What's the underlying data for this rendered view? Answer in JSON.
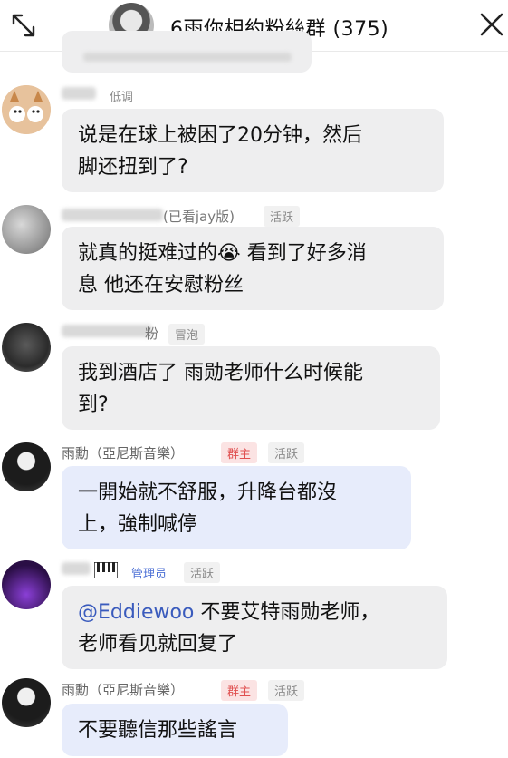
{
  "header": {
    "title": "6雨你相約粉絲群 (375)"
  },
  "messages": [
    {
      "name_suffix": "",
      "role": "低调",
      "text": "说是在球上被困了20分钟，然后\n脚还扭到了?"
    },
    {
      "name_suffix": "(已看jay版)",
      "role": "活跃",
      "text": "就真的挺难过的😭 看到了好多消\n息 他还在安慰粉丝"
    },
    {
      "name_suffix": "粉",
      "role": "冒泡",
      "text": "我到酒店了 雨勋老师什么时候能\n到?"
    },
    {
      "name": "雨勳（亞尼斯音樂）",
      "tag": "群主",
      "role": "活跃",
      "text": "一開始就不舒服，升降台都沒\n上，強制喊停"
    },
    {
      "tag": "管理员",
      "role": "活跃",
      "mention": "@Eddiewoo",
      "text": " 不要艾特雨勋老师，\n老师看见就回复了"
    },
    {
      "name": "雨勳（亞尼斯音樂）",
      "tag": "群主",
      "role": "活跃",
      "text": "不要聽信那些謠言"
    }
  ],
  "colors": {
    "bubble_gray": "#eeeeef",
    "bubble_blue": "#e7ecfb",
    "owner_tag": "#e05050",
    "admin_tag": "#4f72d6"
  }
}
